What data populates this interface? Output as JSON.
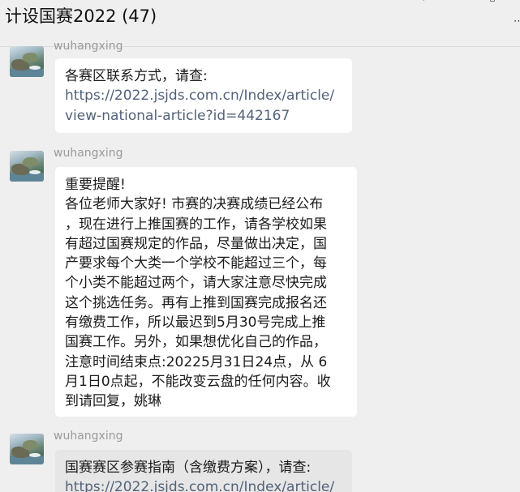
{
  "header": {
    "title": "计设国赛2022 (47)",
    "menu_icon": "more-dots-icon"
  },
  "messages": [
    {
      "sender": "wuhangxing",
      "lines": [
        {
          "text": "各赛区联系方式，请查:",
          "link": false
        },
        {
          "text": "https://2022.jsjds.com.cn/Index/article/",
          "link": true
        },
        {
          "text": "view-national-article?id=442167",
          "link": true
        }
      ]
    },
    {
      "sender": "wuhangxing",
      "lines": [
        {
          "text": "重要提醒!",
          "link": false
        },
        {
          "text": "各位老师大家好! 市赛的决赛成绩已经公布",
          "link": false
        },
        {
          "text": "，现在进行上推国赛的工作，请各学校如果",
          "link": false
        },
        {
          "text": "有超过国赛规定的作品，尽量做出决定，国",
          "link": false
        },
        {
          "text": "产要求每个大类一个学校不能超过三个，每",
          "link": false
        },
        {
          "text": "个小类不能超过两个，请大家注意尽快完成",
          "link": false
        },
        {
          "text": "这个挑选任务。再有上推到国赛完成报名还",
          "link": false
        },
        {
          "text": "有缴费工作，所以最迟到5月30号完成上推",
          "link": false
        },
        {
          "text": "国赛工作。另外，如果想优化自己的作品，",
          "link": false
        },
        {
          "text": "注意时间结束点:20225月31日24点，从 6",
          "link": false
        },
        {
          "text": "月1日0点起，不能改变云盘的任何内容。收",
          "link": false
        },
        {
          "text": "到请回复，姚琳",
          "link": false
        }
      ]
    },
    {
      "sender": "wuhangxing",
      "lines": [
        {
          "text": "国赛赛区参赛指南（含缴费方案），请查:",
          "link": false
        },
        {
          "text": "https://2022.jsjds.com.cn/Index/article/",
          "link": true
        }
      ]
    }
  ]
}
